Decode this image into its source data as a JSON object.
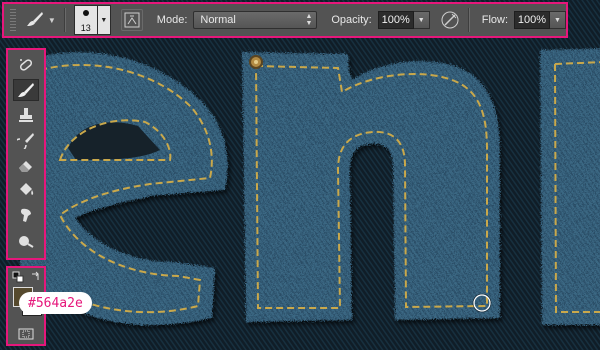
{
  "options_bar": {
    "tool_icon": "brush-icon",
    "brush_size": "13",
    "brush_panel_icon": "brush-panel-toggle-icon",
    "mode_label": "Mode:",
    "mode_value": "Normal",
    "opacity_label": "Opacity:",
    "opacity_value": "100%",
    "airbrush_icon": "pressure-for-opacity-icon",
    "flow_label": "Flow:",
    "flow_value": "100%"
  },
  "toolbox": {
    "tools": [
      {
        "name": "spot-healing-brush-icon",
        "active": false
      },
      {
        "name": "brush-icon",
        "active": true
      },
      {
        "name": "clone-stamp-icon",
        "active": false
      },
      {
        "name": "history-brush-icon",
        "active": false
      },
      {
        "name": "eraser-icon",
        "active": false
      },
      {
        "name": "paint-bucket-icon",
        "active": false
      },
      {
        "name": "smudge-icon",
        "active": false
      },
      {
        "name": "dodge-icon",
        "active": false
      }
    ]
  },
  "colors": {
    "foreground": "#564a2e",
    "background": "#ffffff",
    "hex_label": "#564a2e"
  },
  "annotation_color": "#e6177b",
  "denim_color": "#3c6a86",
  "stitch_color": "#c9a84c"
}
